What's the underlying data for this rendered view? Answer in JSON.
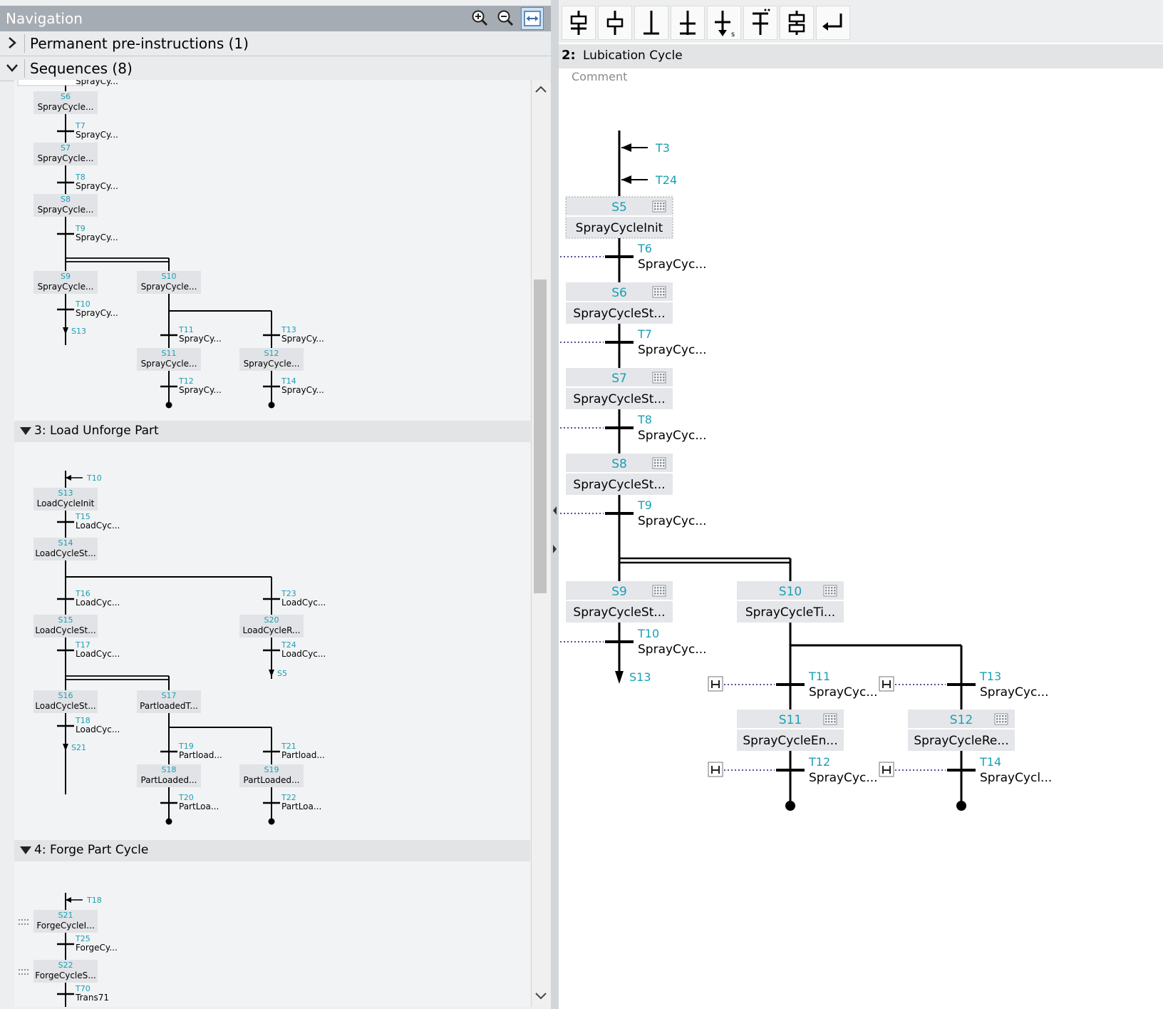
{
  "navigation": {
    "title": "Navigation",
    "zoom_in_icon": "zoom-in-icon",
    "zoom_out_icon": "zoom-out-icon",
    "fit_icon": "fit-width-icon",
    "sections": [
      {
        "label": "Permanent pre-instructions (1)",
        "expanded": false
      },
      {
        "label": "Sequences (8)",
        "expanded": true
      }
    ]
  },
  "overview": {
    "seq2": {
      "top_label": "SprayCy...",
      "steps": [
        {
          "id": "S6",
          "name": "SprayCycle..."
        },
        {
          "id": "S7",
          "name": "SprayCycle..."
        },
        {
          "id": "S8",
          "name": "SprayCycle..."
        },
        {
          "id": "S9",
          "name": "SprayCycle..."
        },
        {
          "id": "S10",
          "name": "SprayCycle..."
        },
        {
          "id": "S11",
          "name": "SprayCycle..."
        },
        {
          "id": "S12",
          "name": "SprayCycle..."
        }
      ],
      "transitions": [
        {
          "id": "T7",
          "name": "SprayCy..."
        },
        {
          "id": "T8",
          "name": "SprayCy..."
        },
        {
          "id": "T9",
          "name": "SprayCy..."
        },
        {
          "id": "T10",
          "name": "SprayCy..."
        },
        {
          "id": "T11",
          "name": "SprayCy..."
        },
        {
          "id": "T13",
          "name": "SprayCy..."
        },
        {
          "id": "T12",
          "name": "SprayCy..."
        },
        {
          "id": "T14",
          "name": "SprayCy..."
        }
      ],
      "jump": "S13"
    },
    "seq3": {
      "header": "3: Load Unforge Part",
      "entry": "T10",
      "steps": [
        {
          "id": "S13",
          "name": "LoadCycleInit"
        },
        {
          "id": "S14",
          "name": "LoadCycleSt..."
        },
        {
          "id": "S15",
          "name": "LoadCycleSt..."
        },
        {
          "id": "S20",
          "name": "LoadCycleR..."
        },
        {
          "id": "S16",
          "name": "LoadCycleSt..."
        },
        {
          "id": "S17",
          "name": "PartloadedT..."
        },
        {
          "id": "S18",
          "name": "PartLoaded..."
        },
        {
          "id": "S19",
          "name": "PartLoaded..."
        }
      ],
      "transitions": [
        {
          "id": "T15",
          "name": "LoadCyc..."
        },
        {
          "id": "T16",
          "name": "LoadCyc..."
        },
        {
          "id": "T23",
          "name": "LoadCyc..."
        },
        {
          "id": "T17",
          "name": "LoadCyc..."
        },
        {
          "id": "T24",
          "name": "LoadCyc..."
        },
        {
          "id": "T18",
          "name": "LoadCyc..."
        },
        {
          "id": "T19",
          "name": "Partload..."
        },
        {
          "id": "T21",
          "name": "Partload..."
        },
        {
          "id": "T20",
          "name": "PartLoa..."
        },
        {
          "id": "T22",
          "name": "PartLoa..."
        }
      ],
      "jumps": [
        "S5",
        "S21"
      ]
    },
    "seq4": {
      "header": "4: Forge Part Cycle",
      "entry": "T18",
      "steps": [
        {
          "id": "S21",
          "name": "ForgeCycleI..."
        },
        {
          "id": "S22",
          "name": "ForgeCycleS..."
        }
      ],
      "transitions": [
        {
          "id": "T25",
          "name": "ForgeCy..."
        },
        {
          "id": "T70",
          "name": "Trans71"
        }
      ]
    }
  },
  "toolbar": {
    "buttons": [
      "insert-step-transition-icon",
      "insert-step-icon",
      "insert-transition-icon",
      "insert-alternative-branch-icon",
      "insert-jump-icon",
      "insert-simultaneous-branch-icon",
      "close-branch-icon",
      "sequence-end-icon"
    ]
  },
  "editor": {
    "sequence_number": "2:",
    "sequence_name": "Lubication Cycle",
    "comment_placeholder": "Comment",
    "entry_transitions": [
      "T3",
      "T24"
    ],
    "steps": [
      {
        "id": "S5",
        "name": "SprayCycleInit"
      },
      {
        "id": "S6",
        "name": "SprayCycleSt..."
      },
      {
        "id": "S7",
        "name": "SprayCycleSt..."
      },
      {
        "id": "S8",
        "name": "SprayCycleSt..."
      },
      {
        "id": "S9",
        "name": "SprayCycleSt..."
      },
      {
        "id": "S10",
        "name": "SprayCycleTi..."
      },
      {
        "id": "S11",
        "name": "SprayCycleEn..."
      },
      {
        "id": "S12",
        "name": "SprayCycleRe..."
      }
    ],
    "transitions": [
      {
        "id": "T6",
        "name": "SprayCyc..."
      },
      {
        "id": "T7",
        "name": "SprayCyc..."
      },
      {
        "id": "T8",
        "name": "SprayCyc..."
      },
      {
        "id": "T9",
        "name": "SprayCyc..."
      },
      {
        "id": "T10",
        "name": "SprayCyc..."
      },
      {
        "id": "T11",
        "name": "SprayCyc..."
      },
      {
        "id": "T13",
        "name": "SprayCyc..."
      },
      {
        "id": "T12",
        "name": "SprayCyc..."
      },
      {
        "id": "T14",
        "name": "SprayCycl..."
      }
    ],
    "jump_target": "S13",
    "colors": {
      "accent": "#1a9fb5",
      "step_fill": "#e4e6e9",
      "line": "#000000"
    }
  }
}
